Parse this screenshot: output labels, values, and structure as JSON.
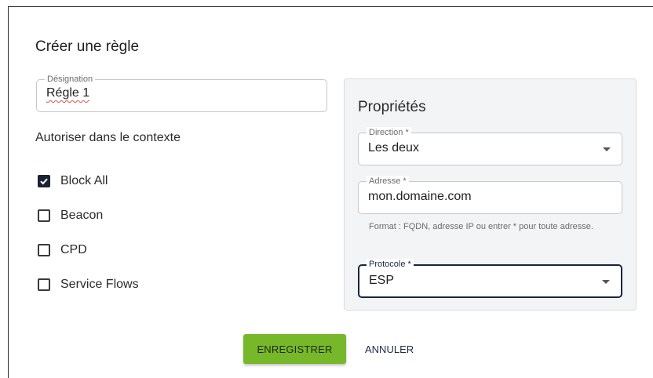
{
  "dialog": {
    "title": "Créer une règle",
    "designation": {
      "legend": "Désignation",
      "value": "Régle 1"
    },
    "context_label": "Autoriser dans le contexte",
    "contexts": [
      {
        "label": "Block All",
        "checked": true
      },
      {
        "label": "Beacon",
        "checked": false
      },
      {
        "label": "CPD",
        "checked": false
      },
      {
        "label": "Service Flows",
        "checked": false
      }
    ],
    "properties": {
      "title": "Propriétés",
      "direction": {
        "legend": "Direction *",
        "value": "Les deux"
      },
      "adresse": {
        "legend": "Adresse *",
        "value": "mon.domaine.com"
      },
      "helper": "Format : FQDN, adresse IP ou entrer * pour toute adresse.",
      "protocole": {
        "legend": "Protocole *",
        "value": "ESP"
      }
    },
    "actions": {
      "save_label": "ENREGISTRER",
      "cancel_label": "ANNULER"
    }
  },
  "colors": {
    "accent": "#77b82a",
    "checkbox": "#1b2233",
    "focus_border": "#18253f",
    "panel_bg": "#f3f4f6"
  }
}
